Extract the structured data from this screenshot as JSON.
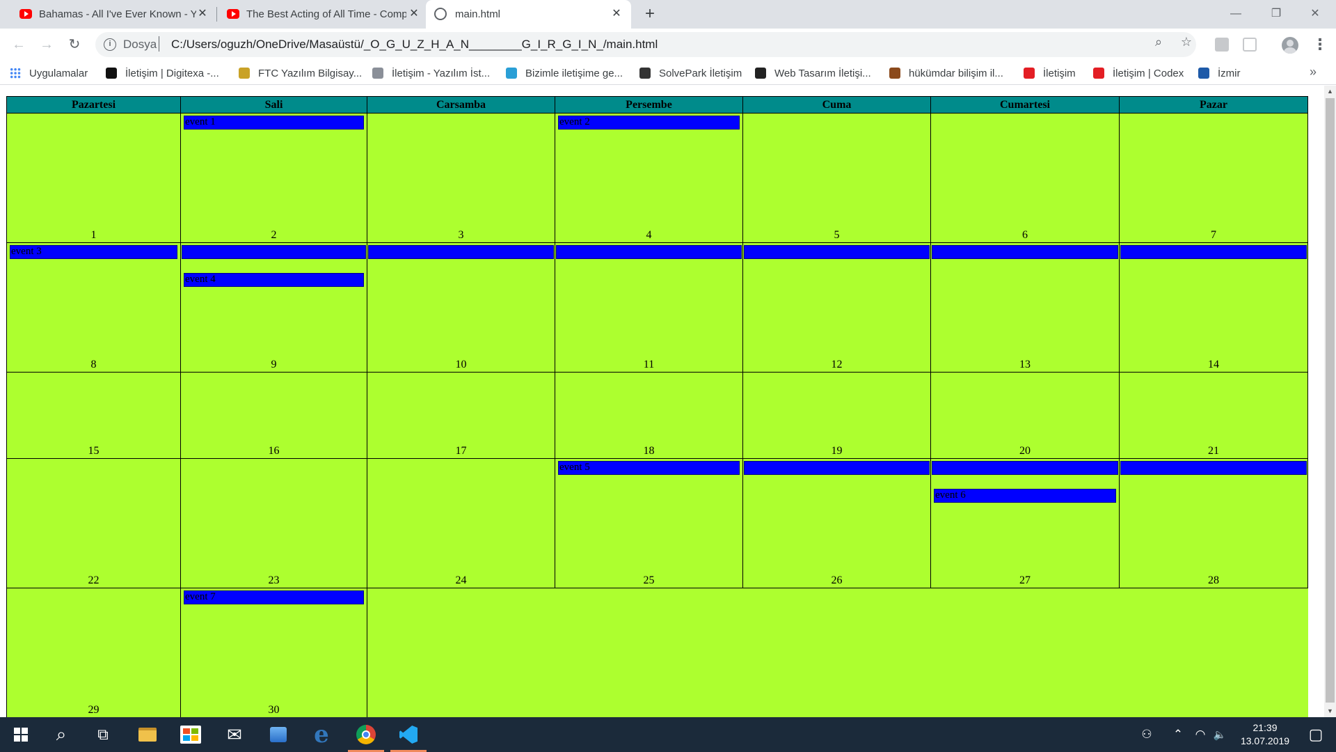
{
  "browser": {
    "tabs": [
      {
        "title": "Bahamas - All I've Ever Known - YouTube",
        "icon": "youtube-icon",
        "active": false
      },
      {
        "title": "The Best Acting of All Time - Compilation",
        "icon": "youtube-icon",
        "active": false
      },
      {
        "title": "main.html",
        "icon": "globe-icon",
        "active": true
      }
    ],
    "new_tab": "+",
    "window": {
      "minimize": "—",
      "maximize": "❐",
      "close": "✕"
    },
    "address": {
      "scheme_label": "Dosya",
      "url": "C:/Users/oguzh/OneDrive/Masaüstü/_O_G_U_Z_H_A_N________G_I_R_G_I_N_/main.html"
    },
    "bookmarks": [
      {
        "label": "Uygulamalar",
        "icon": "apps-grid-icon",
        "color": "#4285f4"
      },
      {
        "label": "İletişim | Digitexa -...",
        "icon": "digitexa-icon",
        "color": "#111111"
      },
      {
        "label": "FTC Yazılım Bilgisay...",
        "icon": "ftc-icon",
        "color": "#c9a227"
      },
      {
        "label": "İletişim - Yazılım İst...",
        "icon": "gear-logo-icon",
        "color": "#8a8f98"
      },
      {
        "label": "Bizimle iletişime ge...",
        "icon": "triangle-logo-icon",
        "color": "#2a9fd6"
      },
      {
        "label": "SolvePark İletişim",
        "icon": "solvepark-icon",
        "color": "#333333"
      },
      {
        "label": "Web Tasarım İletişi...",
        "icon": "swirl-logo-icon",
        "color": "#222222"
      },
      {
        "label": "hükümdar bilişim il...",
        "icon": "hukumdar-icon",
        "color": "#8b4a1c"
      },
      {
        "label": "İletişim",
        "icon": "red-logo-icon",
        "color": "#e31e24"
      },
      {
        "label": "İletişim | Codex",
        "icon": "codex-icon",
        "color": "#e31e24"
      },
      {
        "label": "İzmir",
        "icon": "izmir-icon",
        "color": "#1e5aa8"
      }
    ],
    "bookmarks_more": "»"
  },
  "calendar": {
    "colors": {
      "header": "#008b8b",
      "cell": "#adff2f",
      "event": "#0000ff"
    },
    "days": [
      "Pazartesi",
      "Sali",
      "Carsamba",
      "Persembe",
      "Cuma",
      "Cumartesi",
      "Pazar"
    ],
    "weeks": [
      [
        {
          "day": "1",
          "events": []
        },
        {
          "day": "2",
          "events": [
            {
              "label": "event 1",
              "slot": 0
            }
          ]
        },
        {
          "day": "3",
          "events": []
        },
        {
          "day": "4",
          "events": [
            {
              "label": "event 2",
              "slot": 0
            }
          ]
        },
        {
          "day": "5",
          "events": []
        },
        {
          "day": "6",
          "events": []
        },
        {
          "day": "7",
          "events": []
        }
      ],
      [
        {
          "day": "8",
          "events": [
            {
              "label": "event 3",
              "slot": 0
            }
          ]
        },
        {
          "day": "9",
          "events": [
            {
              "label": "",
              "slot": 0,
              "cont": true
            },
            {
              "label": "event 4",
              "slot": 1
            }
          ]
        },
        {
          "day": "10",
          "events": [
            {
              "label": "",
              "slot": 0,
              "cont": true
            }
          ]
        },
        {
          "day": "11",
          "events": [
            {
              "label": "",
              "slot": 0,
              "cont": true
            }
          ]
        },
        {
          "day": "12",
          "events": [
            {
              "label": "",
              "slot": 0,
              "cont": true
            }
          ]
        },
        {
          "day": "13",
          "events": [
            {
              "label": "",
              "slot": 0,
              "cont": true
            }
          ]
        },
        {
          "day": "14",
          "events": [
            {
              "label": "",
              "slot": 0,
              "cont": true
            }
          ]
        }
      ],
      [
        {
          "day": "15",
          "events": []
        },
        {
          "day": "16",
          "events": []
        },
        {
          "day": "17",
          "events": []
        },
        {
          "day": "18",
          "events": []
        },
        {
          "day": "19",
          "events": []
        },
        {
          "day": "20",
          "events": []
        },
        {
          "day": "21",
          "events": []
        }
      ],
      [
        {
          "day": "22",
          "events": []
        },
        {
          "day": "23",
          "events": []
        },
        {
          "day": "24",
          "events": []
        },
        {
          "day": "25",
          "events": [
            {
              "label": "event 5",
              "slot": 0
            }
          ]
        },
        {
          "day": "26",
          "events": [
            {
              "label": "",
              "slot": 0,
              "cont": true
            }
          ]
        },
        {
          "day": "27",
          "events": [
            {
              "label": "",
              "slot": 0,
              "cont": true
            },
            {
              "label": "event 6",
              "slot": 1
            }
          ]
        },
        {
          "day": "28",
          "events": [
            {
              "label": "",
              "slot": 0,
              "cont": true
            }
          ]
        }
      ],
      [
        {
          "day": "29",
          "events": []
        },
        {
          "day": "30",
          "events": [
            {
              "label": "event 7",
              "slot": 0
            }
          ]
        }
      ]
    ]
  },
  "taskbar": {
    "apps": [
      {
        "name": "start-button",
        "icon": "windows-logo-icon"
      },
      {
        "name": "search-button",
        "icon": "search-icon",
        "glyph": "⌕"
      },
      {
        "name": "task-view-button",
        "icon": "task-view-icon",
        "glyph": "⧉"
      },
      {
        "name": "file-explorer-button",
        "icon": "folder-icon",
        "color": "#f0c14b"
      },
      {
        "name": "store-button",
        "icon": "store-bag-icon",
        "color": "#ffffff"
      },
      {
        "name": "mail-button",
        "icon": "mail-icon",
        "glyph": "✉"
      },
      {
        "name": "app-button",
        "icon": "blue-app-icon",
        "color": "#3a8ee6"
      },
      {
        "name": "edge-button",
        "icon": "edge-icon",
        "glyph": "e",
        "color": "#3277bc"
      },
      {
        "name": "chrome-button",
        "icon": "chrome-icon",
        "running": true
      },
      {
        "name": "vscode-button",
        "icon": "vscode-icon",
        "running": true,
        "color": "#23a9f2"
      }
    ],
    "tray": {
      "people": "⚇",
      "chevron": "⌃",
      "network": "◠",
      "volume": "🔈",
      "notifications": "▢"
    },
    "clock": {
      "time": "21:39",
      "date": "13.07.2019"
    }
  }
}
